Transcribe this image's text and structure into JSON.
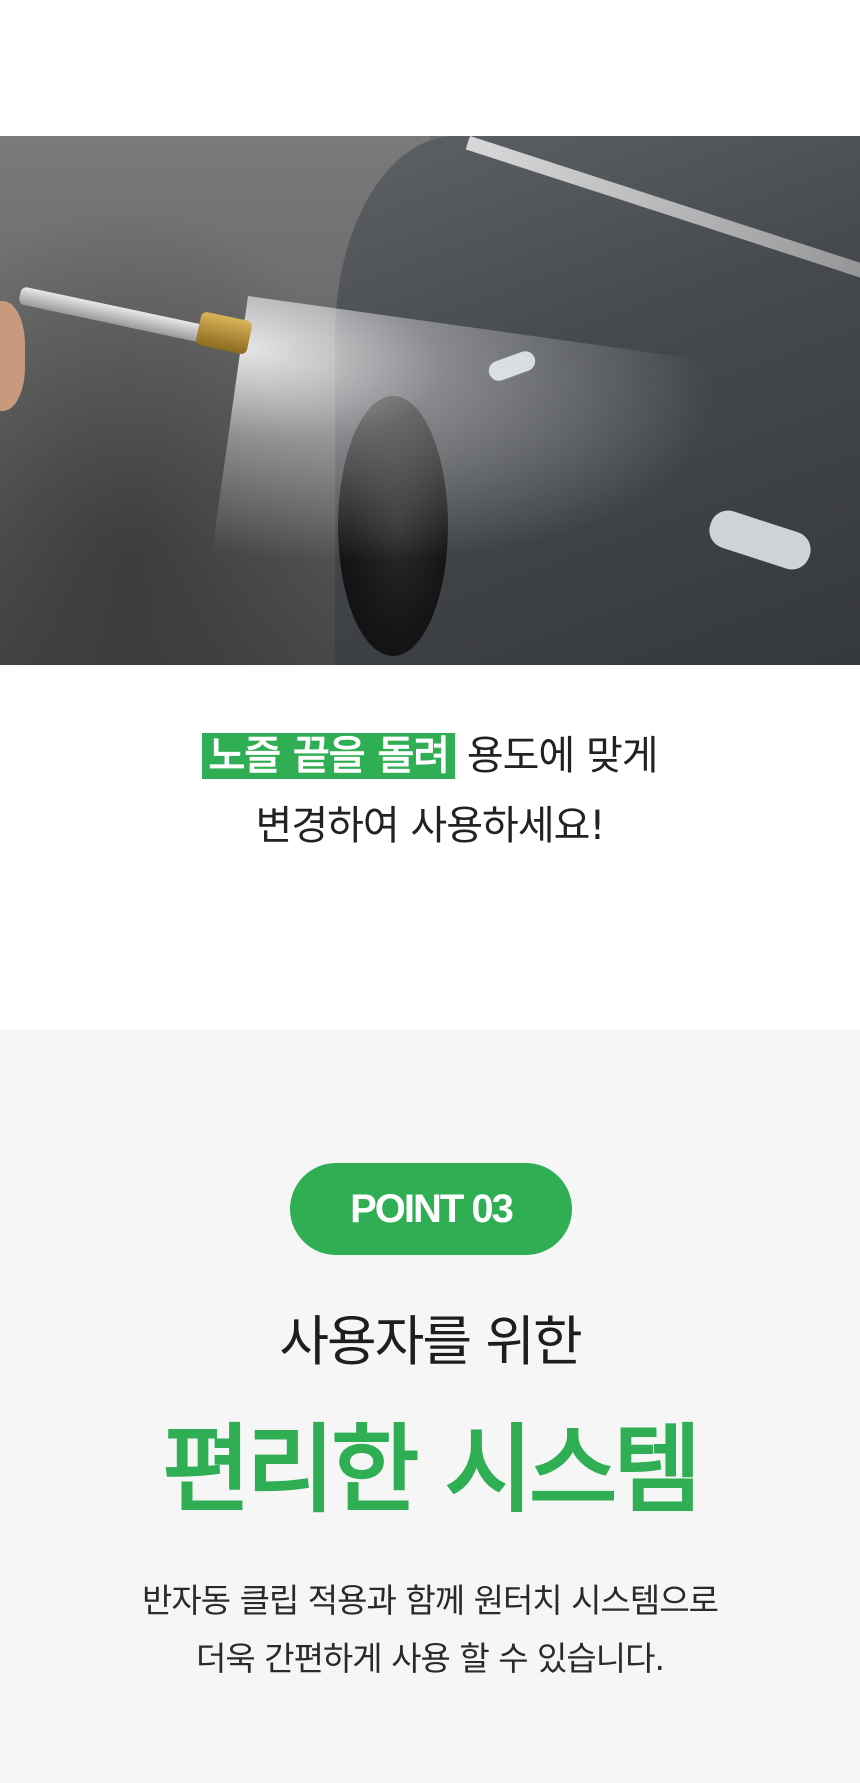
{
  "photo": {
    "description_icon": "car-wash-spray-photo"
  },
  "caption": {
    "highlight": "노즐 끝을 돌려",
    "line1_rest": " 용도에 맞게",
    "line2": "변경하여 사용하세요!"
  },
  "point": {
    "badge": "POINT 03",
    "subtitle": "사용자를 위한",
    "title": "편리한 시스템",
    "desc_line1": "반자동 클립 적용과 함께 원터치 시스템으로",
    "desc_line2": "더욱 간편하게 사용 할 수 있습니다."
  },
  "colors": {
    "accent": "#2fae54",
    "section_bg": "#f6f6f6"
  }
}
